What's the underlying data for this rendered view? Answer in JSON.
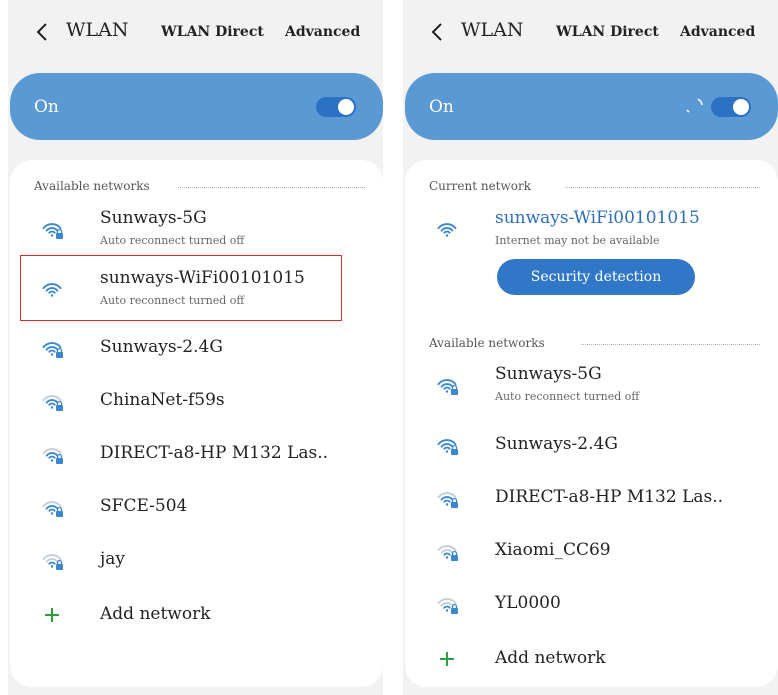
{
  "left": {
    "header": {
      "title": "WLAN",
      "direct": "WLAN Direct",
      "advanced": "Advanced"
    },
    "on_label": "On",
    "section": "Available networks",
    "networks": [
      {
        "name": "Sunways-5G",
        "sub": "Auto reconnect turned off"
      },
      {
        "name": "sunways-WiFi00101015",
        "sub": "Auto reconnect turned off"
      },
      {
        "name": "Sunways-2.4G"
      },
      {
        "name": "ChinaNet-f59s"
      },
      {
        "name": "DIRECT-a8-HP M132 Las.."
      },
      {
        "name": "SFCE-504"
      },
      {
        "name": "jay"
      }
    ],
    "add_network": "Add network"
  },
  "right": {
    "header": {
      "title": "WLAN",
      "direct": "WLAN Direct",
      "advanced": "Advanced"
    },
    "on_label": "On",
    "current_section": "Current network",
    "current": {
      "name": "sunways-WiFi00101015",
      "sub": "Internet may not be available"
    },
    "security_button": "Security detection",
    "section": "Available networks",
    "networks": [
      {
        "name": "Sunways-5G",
        "sub": "Auto reconnect turned off"
      },
      {
        "name": "Sunways-2.4G"
      },
      {
        "name": "DIRECT-a8-HP M132 Las.."
      },
      {
        "name": "Xiaomi_CC69"
      },
      {
        "name": "YL0000"
      }
    ],
    "add_network": "Add network"
  },
  "colors": {
    "accent": "#5b99d4",
    "toggle": "#2c72c4",
    "wifi_icon": "#3a87d0",
    "highlight": "#d9302e",
    "add_plus": "#2e9e3e"
  },
  "icons": {
    "back": "chevron-left-icon",
    "wifi": "wifi-lock-icon",
    "wifi_open": "wifi-icon",
    "add": "plus-icon"
  }
}
